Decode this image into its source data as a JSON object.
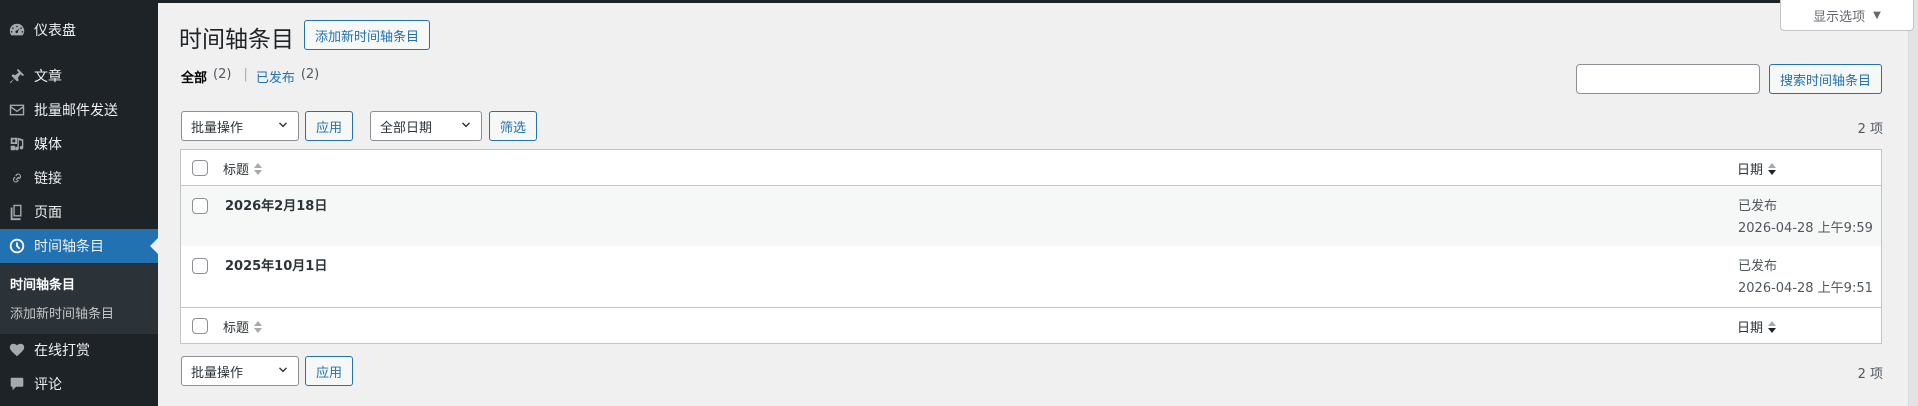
{
  "sidebar": {
    "items": [
      {
        "label": "仪表盘",
        "icon": "dashboard-icon"
      },
      {
        "label": "文章",
        "icon": "pin-icon"
      },
      {
        "label": "批量邮件发送",
        "icon": "email-icon"
      },
      {
        "label": "媒体",
        "icon": "media-icon"
      },
      {
        "label": "链接",
        "icon": "link-icon"
      },
      {
        "label": "页面",
        "icon": "pages-icon"
      },
      {
        "label": "时间轴条目",
        "icon": "clock-icon"
      },
      {
        "label": "在线打赏",
        "icon": "heart-icon"
      },
      {
        "label": "评论",
        "icon": "comment-icon"
      }
    ],
    "submenu": [
      {
        "label": "时间轴条目"
      },
      {
        "label": "添加新时间轴条目"
      }
    ]
  },
  "header": {
    "screen_options_label": "显示选项",
    "title": "时间轴条目",
    "add_new_label": "添加新时间轴条目"
  },
  "views": {
    "all_label": "全部",
    "all_count": "(2)",
    "separator": "|",
    "published_label": "已发布",
    "published_count": "(2)"
  },
  "search": {
    "value": "",
    "button_label": "搜索时间轴条目"
  },
  "tablenav_top": {
    "bulk_action": "批量操作",
    "apply_label": "应用",
    "date_filter": "全部日期",
    "filter_label": "筛选",
    "count": "2 项"
  },
  "table": {
    "columns": {
      "title": "标题",
      "date": "日期"
    },
    "rows": [
      {
        "title": "2026年2月18日",
        "status": "已发布",
        "date": "2026-04-28 上午9:59"
      },
      {
        "title": "2025年10月1日",
        "status": "已发布",
        "date": "2026-04-28 上午9:51"
      }
    ]
  },
  "tablenav_bottom": {
    "bulk_action": "批量操作",
    "apply_label": "应用",
    "count": "2 项"
  },
  "colors": {
    "sidebar_bg": "#1d2327",
    "accent": "#2271b1",
    "page_bg": "#f0f0f1"
  }
}
